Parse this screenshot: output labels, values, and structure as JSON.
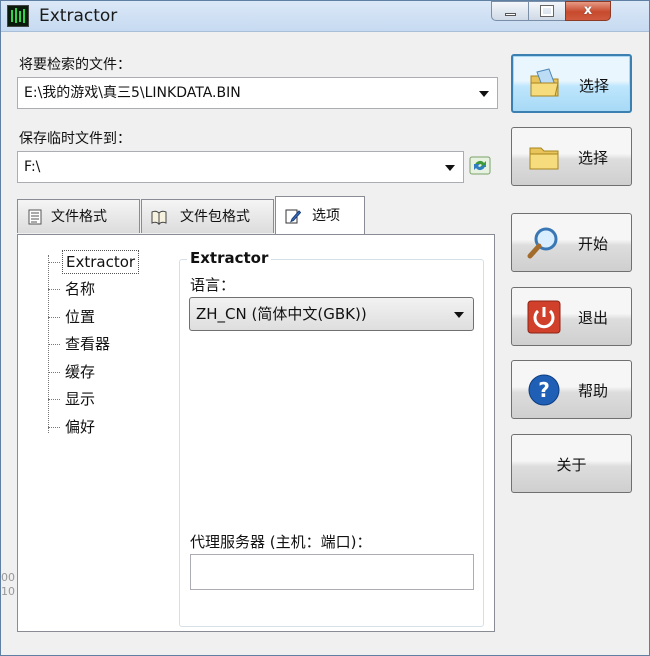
{
  "window": {
    "title": "Extractor",
    "close_glyph": "x"
  },
  "fields": {
    "search_file_label": "将要检索的文件：",
    "search_file_value": "E:\\我的游戏\\真三5\\LINKDATA.BIN",
    "temp_save_label": "保存临时文件到：",
    "temp_save_value": "F:\\"
  },
  "tabs": [
    {
      "label": "文件格式",
      "icon": "document-icon"
    },
    {
      "label": "文件包格式",
      "icon": "book-icon"
    },
    {
      "label": "选项",
      "icon": "settings-icon",
      "active": true
    }
  ],
  "tree": {
    "items": [
      "Extractor",
      "名称",
      "位置",
      "查看器",
      "缓存",
      "显示",
      "偏好"
    ],
    "selected": "Extractor"
  },
  "options_group": {
    "title": "Extractor",
    "language_label": "语言：",
    "language_value": "ZH_CN (简体中文(GBK))",
    "proxy_label": "代理服务器 (主机：端口)：",
    "proxy_value": ""
  },
  "buttons": {
    "select_file": "选择",
    "select_folder": "选择",
    "start": "开始",
    "exit": "退出",
    "help": "帮助",
    "about": "关于"
  },
  "edge_text": [
    "00",
    "10"
  ],
  "colors": {
    "titlebar": "#c6daf1",
    "focus_border": "#3c7fb1",
    "close_button": "#c74a2d",
    "exit_icon": "#d0402a",
    "help_icon": "#1f5fb5"
  }
}
